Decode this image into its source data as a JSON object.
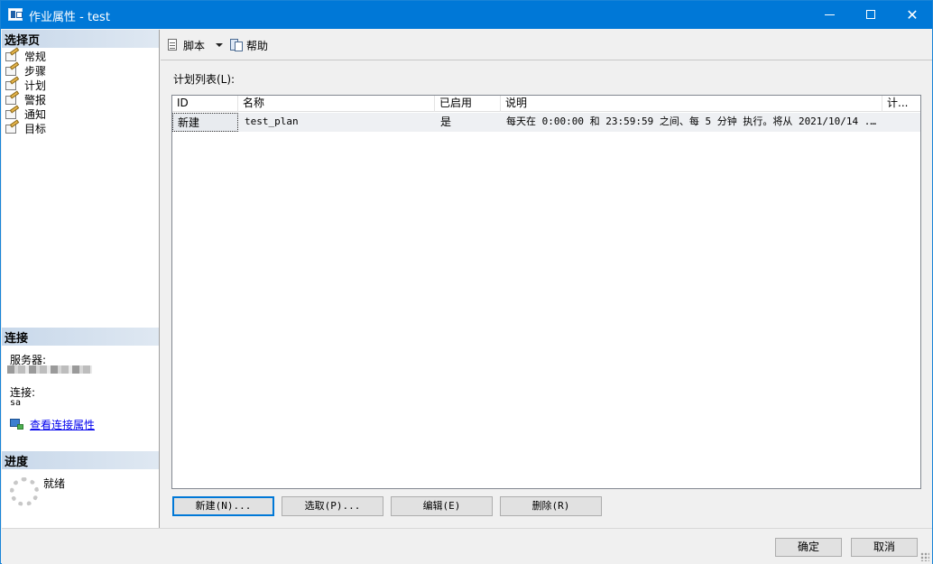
{
  "window": {
    "title": "作业属性 - test"
  },
  "left": {
    "select_page_header": "选择页",
    "pages": [
      {
        "label": "常规"
      },
      {
        "label": "步骤"
      },
      {
        "label": "计划"
      },
      {
        "label": "警报"
      },
      {
        "label": "通知"
      },
      {
        "label": "目标"
      }
    ],
    "connection_header": "连接",
    "server_label": "服务器:",
    "connection_label": "连接:",
    "connection_value": "sa",
    "view_connection_link": "查看连接属性",
    "progress_header": "进度",
    "progress_status": "就绪"
  },
  "toolbar": {
    "script_label": "脚本",
    "help_label": "帮助"
  },
  "schedule": {
    "list_label": "计划列表(L):",
    "columns": [
      "ID",
      "名称",
      "已启用",
      "说明",
      "计..."
    ],
    "rows": [
      {
        "id": "新建",
        "name": "test_plan",
        "enabled": "是",
        "description": "每天在 0:00:00 和 23:59:59 之间、每 5 分钟 执行。将从 2021/10/14 ..."
      }
    ]
  },
  "actions": {
    "new": "新建(N)...",
    "pick": "选取(P)...",
    "edit": "编辑(E)",
    "delete": "删除(R)"
  },
  "footer": {
    "ok": "确定",
    "cancel": "取消"
  }
}
